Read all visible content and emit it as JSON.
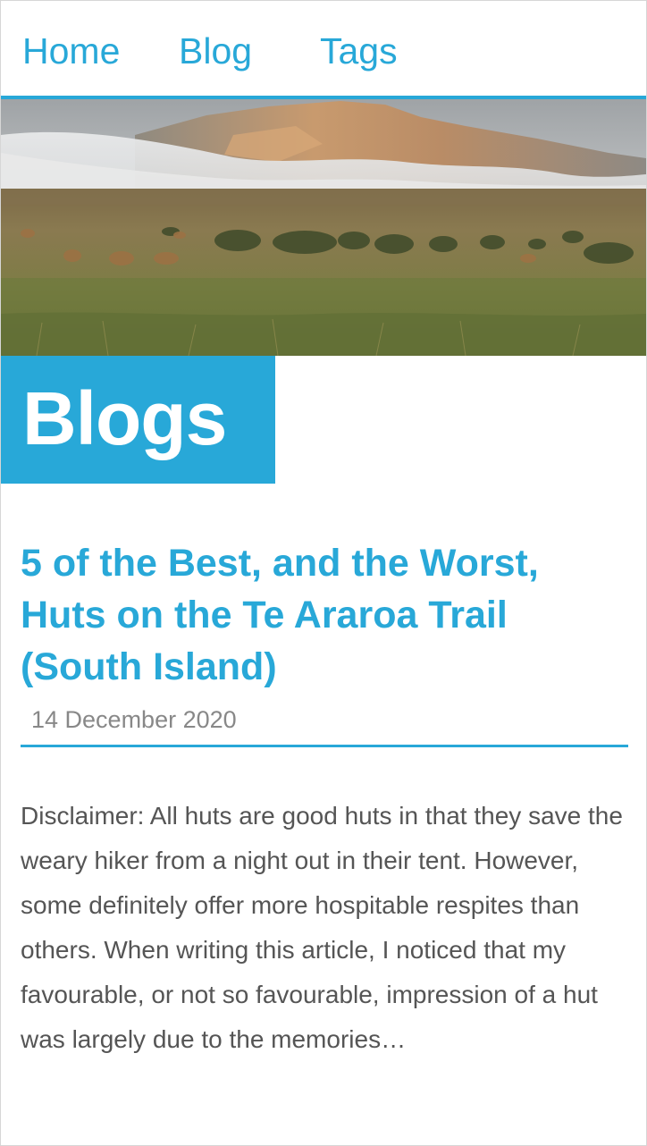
{
  "nav": {
    "items": [
      {
        "label": "Home"
      },
      {
        "label": "Blog"
      },
      {
        "label": "Tags"
      }
    ],
    "accent": "#28a8d8"
  },
  "hero": {
    "image": "landscape-photo-tussock-plain-misty-mountains"
  },
  "page": {
    "title": "Blogs"
  },
  "posts": [
    {
      "title": "5 of the Best, and the Worst, Huts on the Te Araroa Trail (South Island)",
      "date": "14 December 2020",
      "excerpt": "Disclaimer: All huts are good huts in that they save the weary hiker from a night out in their tent. However, some definitely offer more hospitable respites than others. When writing this article, I noticed that my favourable, or not so favourable, impression of a hut was largely due to the memories…"
    }
  ]
}
